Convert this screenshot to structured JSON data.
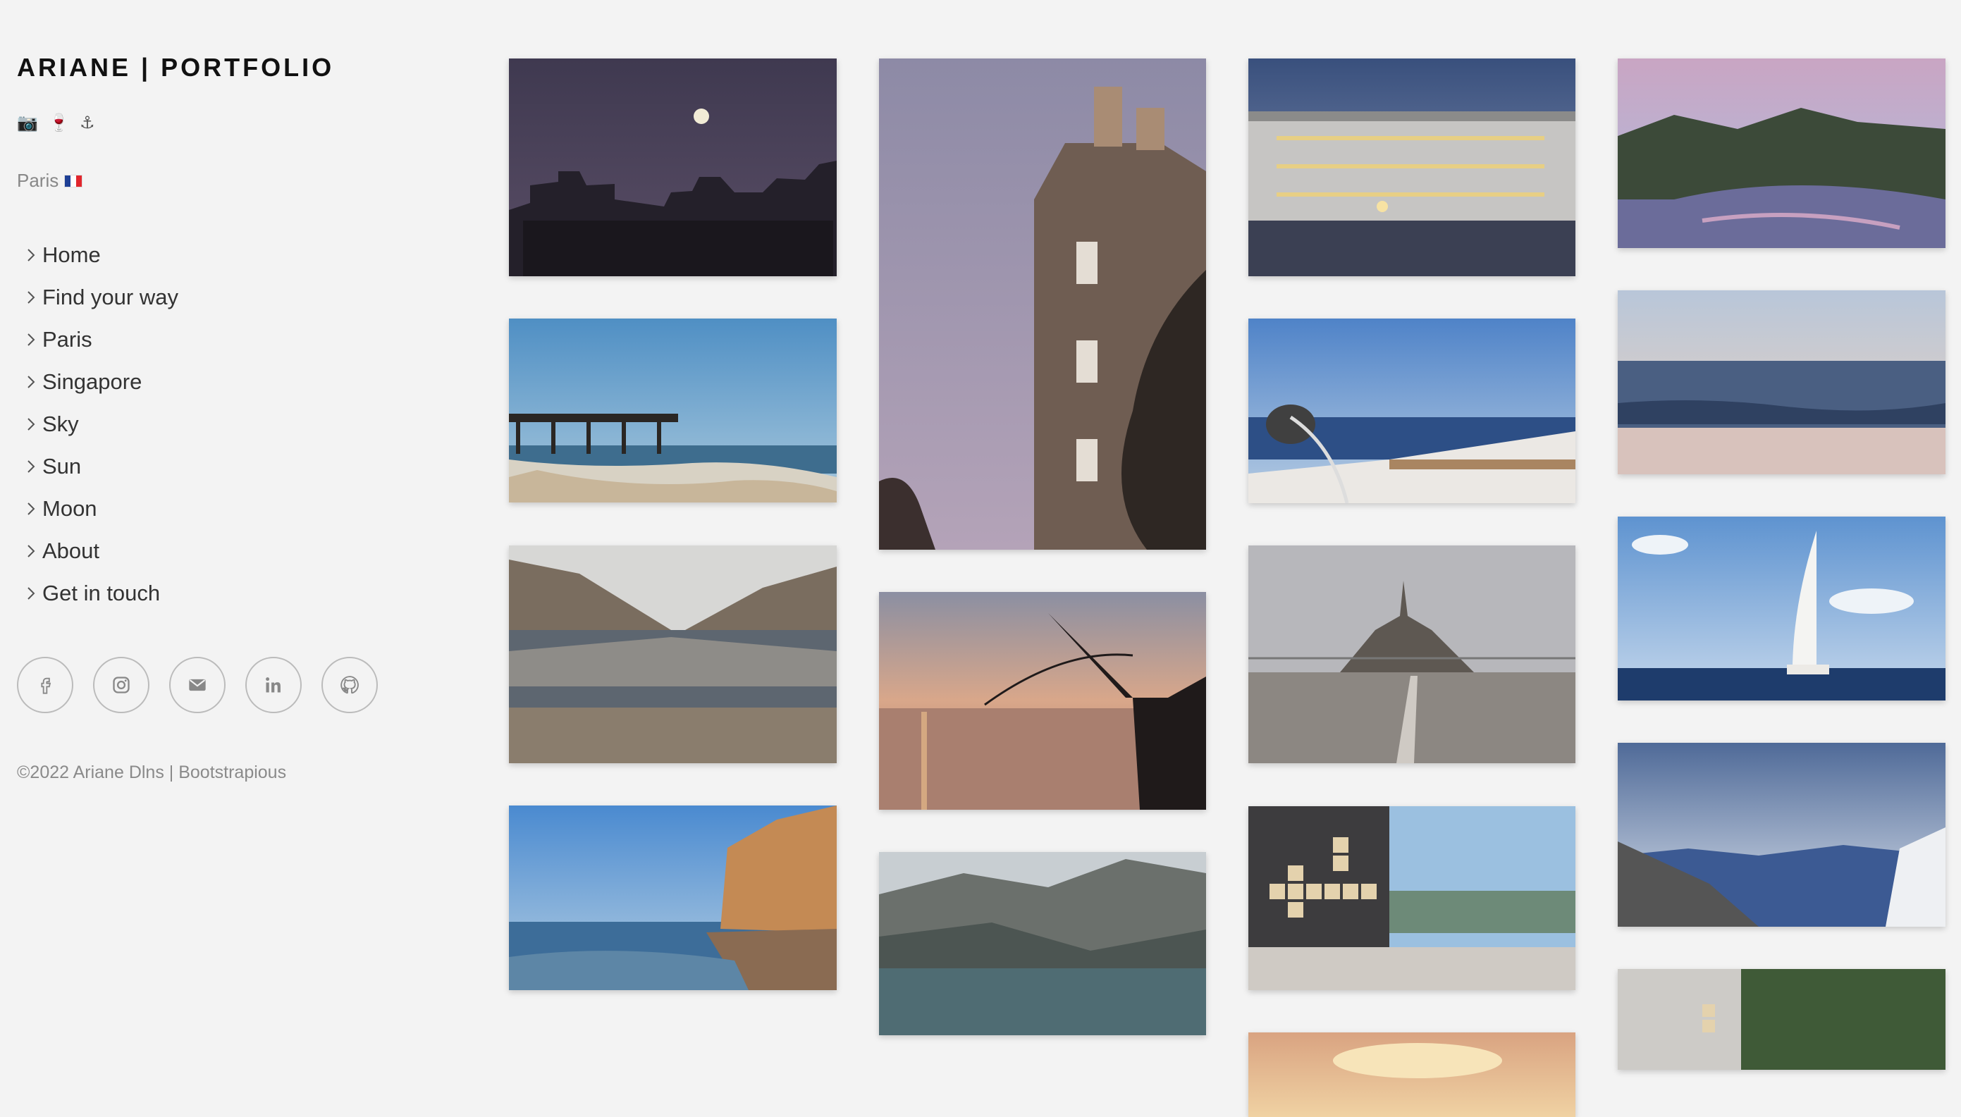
{
  "brand": {
    "title": "ARIANE | PORTFOLIO"
  },
  "emojis": "📷 🍷 ⚓",
  "location": {
    "city": "Paris"
  },
  "nav": {
    "items": [
      {
        "label": "Home"
      },
      {
        "label": "Find your way"
      },
      {
        "label": "Paris"
      },
      {
        "label": "Singapore"
      },
      {
        "label": "Sky"
      },
      {
        "label": "Sun"
      },
      {
        "label": "Moon"
      },
      {
        "label": "About"
      },
      {
        "label": "Get in touch"
      }
    ]
  },
  "socials": [
    {
      "icon": "facebook-icon"
    },
    {
      "icon": "instagram-icon"
    },
    {
      "icon": "email-icon"
    },
    {
      "icon": "linkedin-icon"
    },
    {
      "icon": "github-icon"
    }
  ],
  "footer": {
    "copyright": "©2022 Ariane Dlns | ",
    "credit": "Bootstrapious"
  },
  "colors": {
    "background": "#f3f3f3",
    "text": "#333333",
    "muted": "#8a8a8a"
  },
  "gallery": {
    "photos": [
      {
        "subject": "moon-over-rooftops"
      },
      {
        "subject": "pier-beach"
      },
      {
        "subject": "rocky-reflection"
      },
      {
        "subject": "cliff-beach"
      },
      {
        "subject": "paris-building"
      },
      {
        "subject": "harbor-crane-sunset"
      },
      {
        "subject": "mountain-lake-reflection"
      },
      {
        "subject": "palace-at-dusk"
      },
      {
        "subject": "sailboat-rope"
      },
      {
        "subject": "mont-saint-michel"
      },
      {
        "subject": "scrabble-tiles"
      },
      {
        "subject": "sunset-sky"
      },
      {
        "subject": "bay-hills"
      },
      {
        "subject": "ocean-waves"
      },
      {
        "subject": "sailboat"
      },
      {
        "subject": "mountain-valley"
      },
      {
        "subject": "scrabble-tree"
      }
    ]
  }
}
